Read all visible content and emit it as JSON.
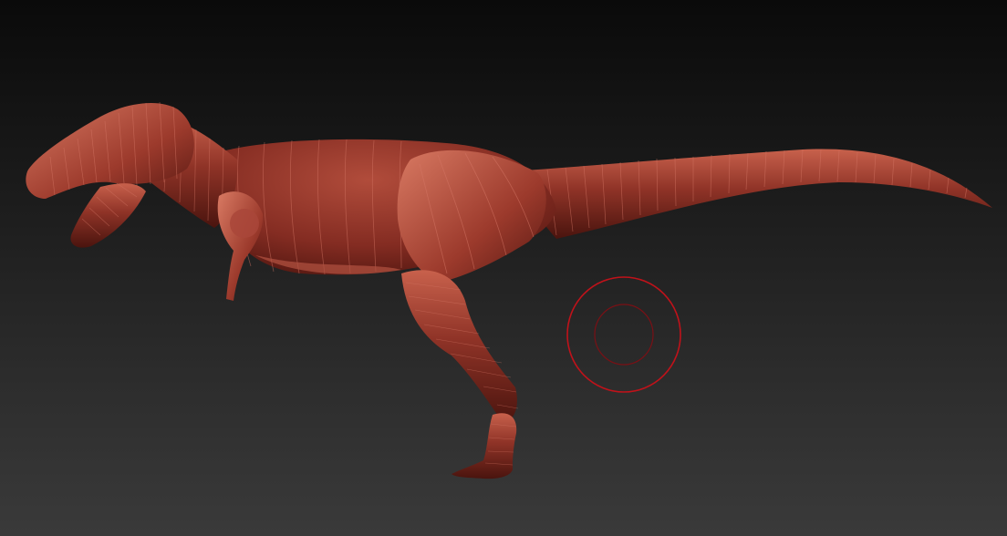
{
  "scene": {
    "model_name": "dinosaur-sculpt",
    "background_top_color": "#0a0a0a",
    "background_bottom_color": "#3a3a3a",
    "material_color": "#8f3327",
    "material_highlight_color": "#c8614c",
    "material_shadow_color": "#4a140e",
    "segment_line_color": "#d57766"
  },
  "brush": {
    "icon": "brush-cursor-icon",
    "ring_color": "#c0121a"
  }
}
